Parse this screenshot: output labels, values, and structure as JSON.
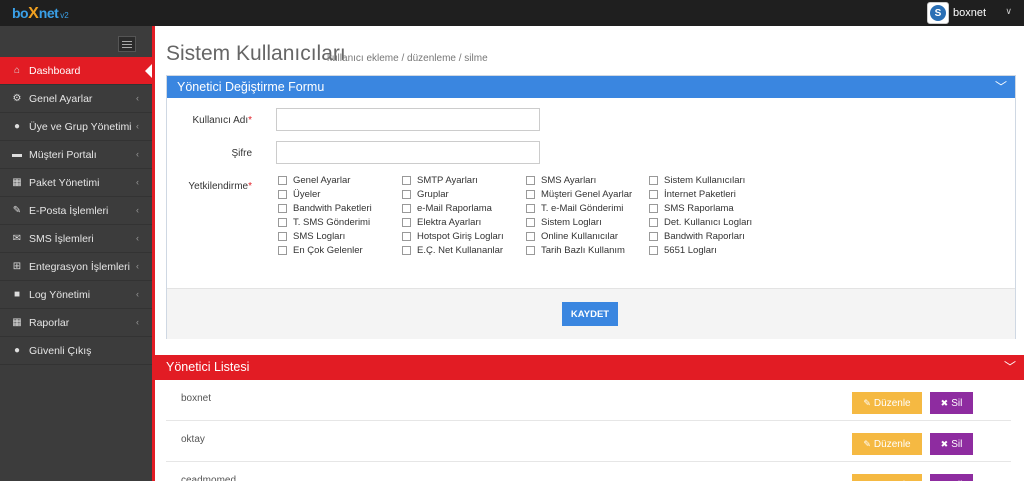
{
  "topbar": {
    "logo_main": "bo",
    "logo_x": "X",
    "logo_tail": "net",
    "logo_version": "v2",
    "user_name": "boxnet",
    "user_caret": "∨"
  },
  "sidebar": {
    "items": [
      {
        "label": "Dashboard",
        "icon": "home-icon",
        "active": true
      },
      {
        "label": "Genel Ayarlar",
        "icon": "cogs-icon"
      },
      {
        "label": "Üye ve Grup Yönetimi",
        "icon": "user-icon"
      },
      {
        "label": "Müşteri Portalı",
        "icon": "folder-icon"
      },
      {
        "label": "Paket Yönetimi",
        "icon": "table-icon"
      },
      {
        "label": "E-Posta İşlemleri",
        "icon": "edit-icon"
      },
      {
        "label": "SMS İşlemleri",
        "icon": "envelope-icon"
      },
      {
        "label": "Entegrasyon İşlemleri",
        "icon": "sitemap-icon"
      },
      {
        "label": "Log Yönetimi",
        "icon": "briefcase-icon"
      },
      {
        "label": "Raporlar",
        "icon": "grid-icon"
      },
      {
        "label": "Güvenli Çıkış",
        "icon": "user-icon"
      }
    ]
  },
  "page": {
    "title": "Sistem Kullanıcıları",
    "subtitle": "kullanıcı ekleme / düzenleme / silme"
  },
  "form": {
    "title": "Yönetici Değiştirme Formu",
    "username_label": "Kullanıcı Adı",
    "username_value": "",
    "password_label": "Şifre",
    "password_value": "",
    "permissions_label": "Yetkilendirme",
    "required_mark": "*",
    "permissions": [
      [
        "Genel Ayarlar",
        "Üyeler",
        "Bandwith Paketleri",
        "T. SMS Gönderimi",
        "SMS Logları",
        "En Çok Gelenler"
      ],
      [
        "SMTP Ayarları",
        "Gruplar",
        "e-Mail Raporlama",
        "Elektra Ayarları",
        "Hotspot Giriş Logları",
        "E.Ç. Net Kullananlar"
      ],
      [
        "SMS Ayarları",
        "Müşteri Genel Ayarlar",
        "T. e-Mail Gönderimi",
        "Sistem Logları",
        "Online Kullanıcılar",
        "Tarih Bazlı Kullanım"
      ],
      [
        "Sistem Kullanıcıları",
        "İnternet Paketleri",
        "SMS Raporlama",
        "Det. Kullanıcı Logları",
        "Bandwith Raporları",
        "5651 Logları"
      ]
    ],
    "save_label": "KAYDET"
  },
  "list": {
    "title": "Yönetici Listesi",
    "edit_label": "Düzenle",
    "delete_label": "Sil",
    "rows": [
      "boxnet",
      "oktay",
      "ceadmomed"
    ]
  },
  "colors": {
    "accent_red": "#e21c24",
    "accent_blue": "#3a86e0",
    "edit_orange": "#f5b942",
    "delete_purple": "#8e2ca0",
    "sidebar_bg": "#3c3c3c"
  }
}
